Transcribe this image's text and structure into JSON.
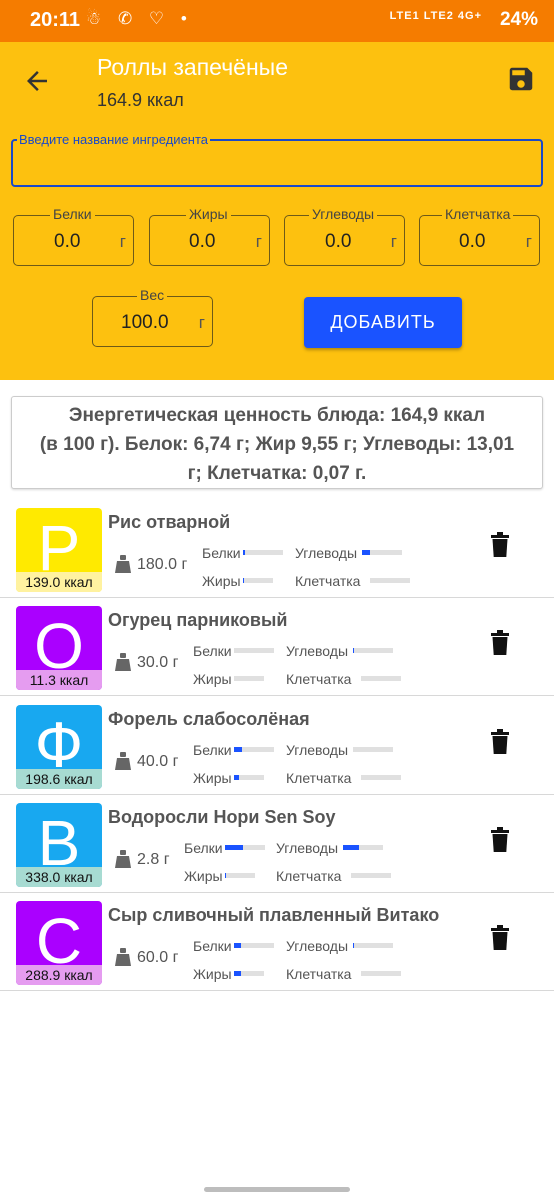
{
  "statusbar": {
    "time": "20:11",
    "left_icons": "☃ ✆ ♡ •",
    "network": "LTE1 LTE2 4G+",
    "battery": "24%"
  },
  "header": {
    "title": "Роллы запечёные",
    "subtitle": "164.9  ккал",
    "back_icon": "arrow-left-icon",
    "save_icon": "floppy-disk-icon"
  },
  "form": {
    "name_label": "Введите название ингредиента",
    "name_value": "",
    "fields": [
      {
        "label": "Белки",
        "value": "0.0",
        "unit": "г"
      },
      {
        "label": "Жиры",
        "value": "0.0",
        "unit": "г"
      },
      {
        "label": "Углеводы",
        "value": "0.0",
        "unit": "г"
      },
      {
        "label": "Клетчатка",
        "value": "0.0",
        "unit": "г"
      }
    ],
    "weight": {
      "label": "Вес",
      "value": "100.0",
      "unit": "г"
    },
    "add_label": "ДОБАВИТЬ"
  },
  "summary": {
    "line1": "Энергетическая ценность блюда: 164,9 ккал",
    "line2": "(в 100 г). Белок: 6,74 г; Жир 9,55 г; Углеводы: 13,01",
    "line3": "г; Клетчатка: 0,07 г."
  },
  "macro_labels": {
    "protein": "Белки",
    "carbs": "Углеводы",
    "fat": "Жиры",
    "fiber": "Клетчатка"
  },
  "items": [
    {
      "letter": "Р",
      "kcal": "139.0 ккал",
      "name": "Рис отварной",
      "weight": "180.0 г",
      "color": "#ffea00",
      "kcal_bg": "#fff2a0",
      "protein": 0.05,
      "carbs": 0.2,
      "fat": 0.03,
      "fiber": 0.0
    },
    {
      "letter": "О",
      "kcal": "11.3 ккал",
      "name": "Огурец парниковый",
      "weight": "30.0 г",
      "color": "#aa00ff",
      "kcal_bg": "#e59cf0",
      "protein": 0.0,
      "carbs": 0.02,
      "fat": 0.0,
      "fiber": 0.0
    },
    {
      "letter": "Ф",
      "kcal": "198.6 ккал",
      "name": "Форель слабосолёная",
      "weight": "40.0 г",
      "color": "#18a8f0",
      "kcal_bg": "#a7dbd2",
      "protein": 0.2,
      "carbs": 0.0,
      "fat": 0.15,
      "fiber": 0.0
    },
    {
      "letter": "В",
      "kcal": "338.0 ккал",
      "name": "Водоросли Нори Sen Soy",
      "weight": "2.8 г",
      "color": "#18a8f0",
      "kcal_bg": "#a7dbd2",
      "protein": 0.45,
      "carbs": 0.4,
      "fat": 0.02,
      "fiber": 0.0
    },
    {
      "letter": "С",
      "kcal": "288.9 ккал",
      "name": "Сыр сливочный плавленный Витако",
      "weight": "60.0 г",
      "color": "#aa00ff",
      "kcal_bg": "#e59cf0",
      "protein": 0.18,
      "carbs": 0.03,
      "fat": 0.22,
      "fiber": 0.0
    }
  ]
}
